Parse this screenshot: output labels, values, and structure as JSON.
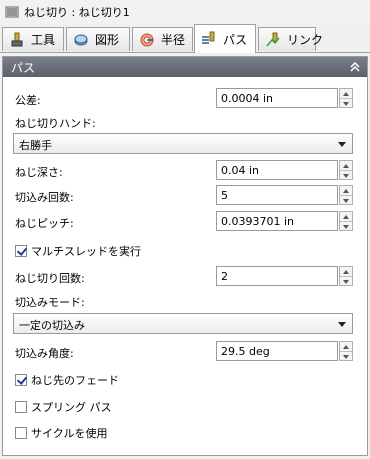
{
  "window": {
    "title": "ねじ切り : ねじ切り1"
  },
  "tabs": [
    {
      "label": "工具",
      "icon": "tool-icon"
    },
    {
      "label": "図形",
      "icon": "geometry-icon"
    },
    {
      "label": "半径",
      "icon": "radius-icon"
    },
    {
      "label": "パス",
      "icon": "passes-icon",
      "active": true
    },
    {
      "label": "リンク",
      "icon": "link-icon"
    }
  ],
  "panel": {
    "title": "パス",
    "tolerance": {
      "label": "公差:",
      "value": "0.0004 in"
    },
    "hand": {
      "label": "ねじ切りハンド:",
      "selected": "右勝手"
    },
    "depth": {
      "label": "ねじ深さ:",
      "value": "0.04 in"
    },
    "plunge_count": {
      "label": "切込み回数:",
      "value": "5"
    },
    "pitch": {
      "label": "ねじピッチ:",
      "value": "0.0393701 in"
    },
    "multistart": {
      "label": "マルチスレッドを実行",
      "checked": true
    },
    "thread_count": {
      "label": "ねじ切り回数:",
      "value": "2"
    },
    "plunge_mode": {
      "label": "切込みモード:",
      "selected": "一定の切込み"
    },
    "infeed_angle": {
      "label": "切込み角度:",
      "value": "29.5 deg"
    },
    "fade": {
      "label": "ねじ先のフェード",
      "checked": true
    },
    "spring_pass": {
      "label": "スプリング パス",
      "checked": false
    },
    "use_cycle": {
      "label": "サイクルを使用",
      "checked": false
    }
  }
}
